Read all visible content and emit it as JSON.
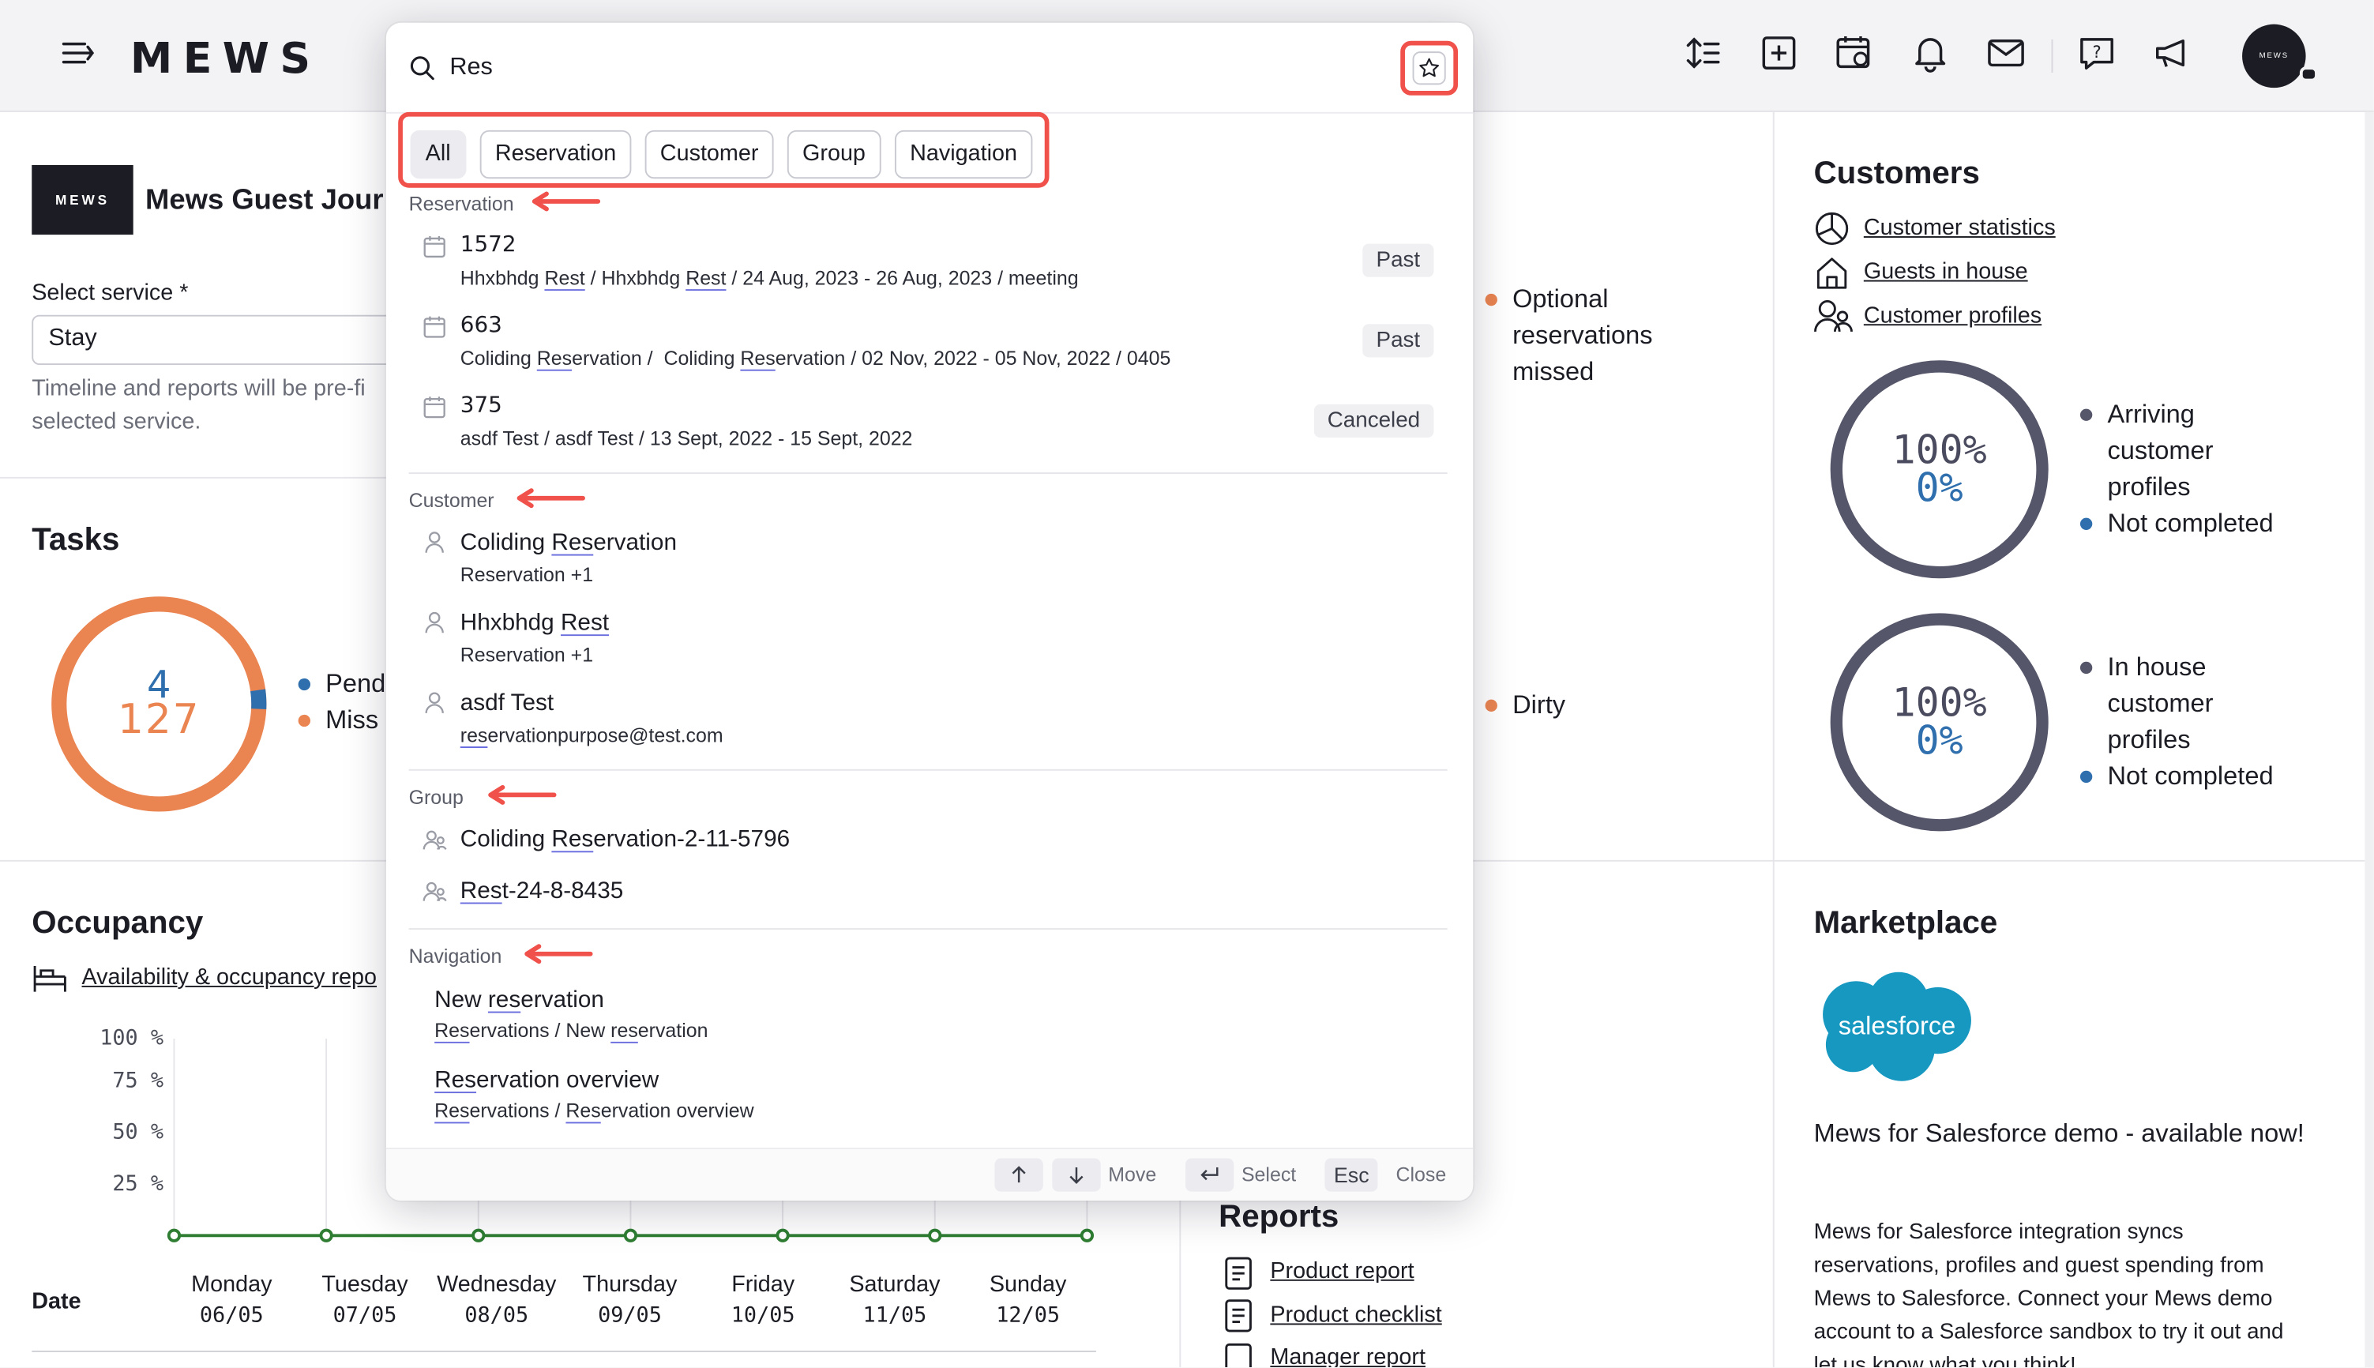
{
  "header": {
    "logo": "MEWS",
    "icons": [
      "menu-icon",
      "sort-icon",
      "add-icon",
      "calendar-view-icon",
      "bell-icon",
      "mail-icon",
      "help-icon",
      "megaphone-icon"
    ],
    "avatar_text": "MEWS"
  },
  "journey": {
    "logo_text": "MEWS",
    "title": "Mews Guest Jour",
    "select_label": "Select service *",
    "select_value": "Stay",
    "hint": "Timeline and reports will be pre-fi",
    "hint2": "selected service."
  },
  "tasks": {
    "title": "Tasks",
    "count_top": "4",
    "count_bottom": "127",
    "legend": [
      "Pend",
      "Miss"
    ],
    "ring_fraction": 0.97,
    "colors": {
      "pending": "#2f6fae",
      "missed": "#ea8451"
    }
  },
  "occupancy": {
    "title": "Occupancy",
    "link": "Availability & occupancy repo",
    "date_label": "Date",
    "chart_data": {
      "type": "line",
      "yticks": [
        "100 %",
        "75 %",
        "50 %",
        "25 %"
      ],
      "categories": [
        "Monday",
        "Tuesday",
        "Wednesday",
        "Thursday",
        "Friday",
        "Saturday",
        "Sunday"
      ],
      "dates": [
        "06/05",
        "07/05",
        "08/05",
        "09/05",
        "10/05",
        "11/05",
        "12/05"
      ],
      "values": [
        0,
        0,
        0,
        0,
        0,
        0,
        0
      ],
      "ylim": [
        0,
        100
      ],
      "color": "#2e7d32"
    }
  },
  "middle": {
    "optional": [
      "Optional",
      "reservations",
      "missed"
    ],
    "dirty": "Dirty",
    "reports_title": "Reports",
    "reports": [
      "Product report",
      "Product checklist",
      "Manager report"
    ]
  },
  "customers": {
    "title": "Customers",
    "links": [
      "Customer statistics",
      "Guests in house",
      "Customer profiles"
    ],
    "gauge1": {
      "top": "100%",
      "bottom": "0%",
      "legend": [
        "Arriving",
        "customer",
        "profiles"
      ],
      "legend2": "Not completed"
    },
    "gauge2": {
      "top": "100%",
      "bottom": "0%",
      "legend": [
        "In house",
        "customer",
        "profiles"
      ],
      "legend2": "Not completed"
    }
  },
  "marketplace": {
    "title": "Marketplace",
    "logo": "salesforce",
    "headline": "Mews for Salesforce demo - available now!",
    "body": [
      "Mews for Salesforce integration syncs",
      "reservations, profiles and guest spending from",
      "Mews to Salesforce. Connect your Mews demo",
      "account to a Salesforce sandbox to try it out and",
      "let us know what you think!"
    ]
  },
  "search": {
    "query": "Res",
    "filters": [
      "All",
      "Reservation",
      "Customer",
      "Group",
      "Navigation"
    ],
    "sections": {
      "reservation": "Reservation",
      "customer": "Customer",
      "group": "Group",
      "navigation": "Navigation"
    },
    "reservations": [
      {
        "id": "1572",
        "sub": "Hhxbhdg Rest / Hhxbhdg Rest / 24 Aug, 2023 - 26 Aug, 2023 / meeting",
        "status": "Past"
      },
      {
        "id": "663",
        "sub": "Coliding Reservation /  Coliding Reservation / 02 Nov, 2022 - 05 Nov, 2022 / 0405",
        "status": "Past"
      },
      {
        "id": "375",
        "sub": "asdf Test / asdf Test / 13 Sept, 2022 - 15 Sept, 2022",
        "status": "Canceled"
      }
    ],
    "customers": [
      {
        "name": "Coliding Reservation",
        "sub": "Reservation +1"
      },
      {
        "name": "Hhxbhdg Rest",
        "sub": "Reservation +1"
      },
      {
        "name": "asdf Test",
        "sub": "reservationpurpose@test.com"
      }
    ],
    "groups": [
      "Coliding Reservation-2-11-5796",
      "Rest-24-8-8435"
    ],
    "navigation": [
      {
        "title": "New reservation",
        "sub": "Reservations / New reservation"
      },
      {
        "title": "Reservation overview",
        "sub": "Reservations / Reservation overview"
      }
    ],
    "footer": {
      "move": "Move",
      "select": "Select",
      "esc": "Esc",
      "close": "Close"
    }
  }
}
